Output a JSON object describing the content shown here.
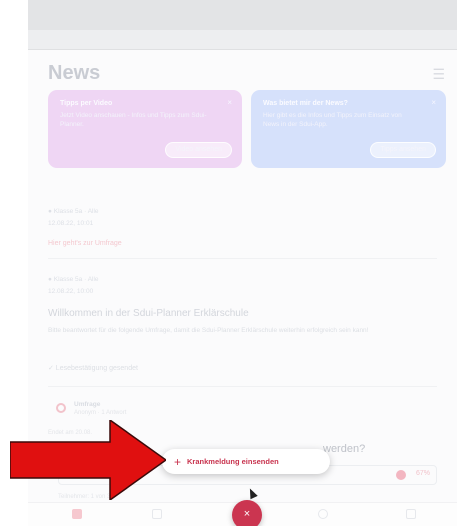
{
  "header": {
    "title": "News",
    "menu_icon": "hamburger-icon"
  },
  "cards": [
    {
      "title": "Tipps per Video",
      "text": "Jetzt Video anschauen - Infos und Tipps zum Sdui-Planner.",
      "button": "Video ansehen",
      "close": "×"
    },
    {
      "title": "Was bietet mir der News?",
      "text": "Hier gibt es die Infos und Tipps zum Einsatz von News in der Sdui-App.",
      "button": "Tipps ansehen",
      "close": "×"
    }
  ],
  "feed": {
    "item1": {
      "meta": "● Klasse 5a  ·  Alle",
      "date": "12.08.22, 10:01",
      "link": "Hier geht's zur Umfrage"
    },
    "item2": {
      "meta": "● Klasse 5a  ·  Alle",
      "date": "12.08.22, 10:00"
    },
    "post_title": "Willkommen in der Sdui-Planner Erklärschule",
    "post_text": "Bitte beantwortet für die folgende Umfrage, damit die Sdui-Planner Erklärschule weiterhin erfolgreich sein kann!",
    "post_check": "✓ Lesebestätigung gesendet"
  },
  "survey": {
    "label": "Umfrage",
    "sub": "Anonym · 1 Antwort",
    "date": "Endet am 20.08.",
    "question_end": "werden?",
    "percent": "67%",
    "participants": "Teilnehmer: 1 von 3"
  },
  "popup": {
    "label": "Krankmeldung einsenden",
    "plus": "+"
  },
  "fab": {
    "icon": "×"
  },
  "colors": {
    "accent": "#c8334e",
    "annotation": "#e01010"
  }
}
